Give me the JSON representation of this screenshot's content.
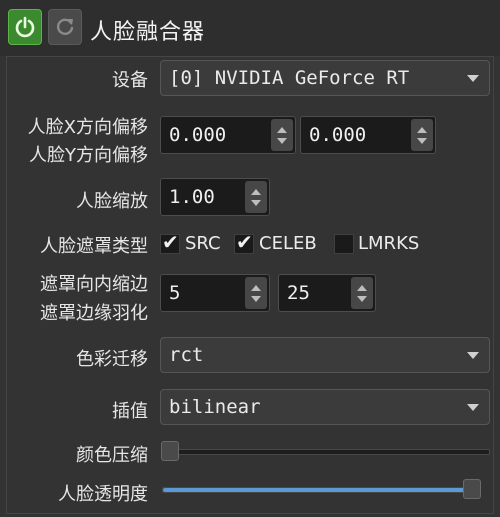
{
  "header": {
    "title": "人脸融合器",
    "power_icon": "power-icon",
    "refresh_icon": "refresh-icon"
  },
  "device": {
    "label": "设备",
    "value": "[0] NVIDIA GeForce RT"
  },
  "offset": {
    "label_x": "人脸X方向偏移",
    "label_y": "人脸Y方向偏移",
    "x_value": "0.000",
    "y_value": "0.000"
  },
  "scale": {
    "label": "人脸缩放",
    "value": "1.00"
  },
  "mask_type": {
    "label": "人脸遮罩类型",
    "options": [
      {
        "label": "SRC",
        "checked": true
      },
      {
        "label": "CELEB",
        "checked": true
      },
      {
        "label": "LMRKS",
        "checked": false
      }
    ]
  },
  "mask": {
    "label_erode": "遮罩向内缩边",
    "label_blur": "遮罩边缘羽化",
    "erode_value": "5",
    "blur_value": "25"
  },
  "color_transfer": {
    "label": "色彩迁移",
    "value": "rct"
  },
  "interpolation": {
    "label": "插值",
    "value": "bilinear"
  },
  "color_compression": {
    "label": "颜色压缩",
    "level": 0.0
  },
  "opacity": {
    "label": "人脸透明度",
    "level": 1.0
  },
  "colors": {
    "accent": "#5b9bd5",
    "power_green": "#3c8a2f"
  }
}
